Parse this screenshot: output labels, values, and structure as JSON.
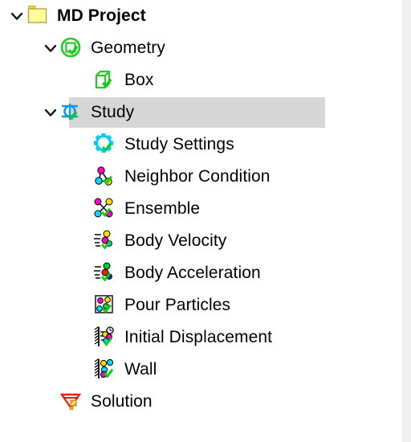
{
  "panel": {
    "name": "model-tree",
    "background": "#ffffff",
    "gutter_color": "#efefef",
    "selection_color": "#d6d6d6"
  },
  "tree": {
    "nodes": [
      {
        "id": "md-project",
        "label": "MD Project",
        "icon": "folder-icon",
        "indent": 0,
        "expanded": true,
        "has_twisty": true,
        "bold": true,
        "selected": false
      },
      {
        "id": "geometry",
        "label": "Geometry",
        "icon": "geometry-icon",
        "indent": 1,
        "expanded": true,
        "has_twisty": true,
        "bold": false,
        "selected": false
      },
      {
        "id": "box",
        "label": "Box",
        "icon": "box-icon",
        "indent": 2,
        "expanded": false,
        "has_twisty": false,
        "bold": false,
        "selected": false
      },
      {
        "id": "study",
        "label": "Study",
        "icon": "study-icon",
        "indent": 1,
        "expanded": true,
        "has_twisty": true,
        "bold": false,
        "selected": true
      },
      {
        "id": "study-settings",
        "label": "Study Settings",
        "icon": "gear-icon",
        "indent": 2,
        "expanded": false,
        "has_twisty": false,
        "bold": false,
        "selected": false
      },
      {
        "id": "neighbor-condition",
        "label": "Neighbor Condition",
        "icon": "neighbor-condition-icon",
        "indent": 2,
        "expanded": false,
        "has_twisty": false,
        "bold": false,
        "selected": false
      },
      {
        "id": "ensemble",
        "label": "Ensemble",
        "icon": "ensemble-icon",
        "indent": 2,
        "expanded": false,
        "has_twisty": false,
        "bold": false,
        "selected": false
      },
      {
        "id": "body-velocity",
        "label": "Body Velocity",
        "icon": "body-velocity-icon",
        "indent": 2,
        "expanded": false,
        "has_twisty": false,
        "bold": false,
        "selected": false
      },
      {
        "id": "body-acceleration",
        "label": "Body Acceleration",
        "icon": "body-acceleration-icon",
        "indent": 2,
        "expanded": false,
        "has_twisty": false,
        "bold": false,
        "selected": false
      },
      {
        "id": "pour-particles",
        "label": "Pour Particles",
        "icon": "pour-particles-icon",
        "indent": 2,
        "expanded": false,
        "has_twisty": false,
        "bold": false,
        "selected": false
      },
      {
        "id": "initial-displacement",
        "label": "Initial Displacement",
        "icon": "initial-displacement-icon",
        "indent": 2,
        "expanded": false,
        "has_twisty": false,
        "bold": false,
        "selected": false
      },
      {
        "id": "wall",
        "label": "Wall",
        "icon": "wall-icon",
        "indent": 2,
        "expanded": false,
        "has_twisty": false,
        "bold": false,
        "selected": false
      },
      {
        "id": "solution",
        "label": "Solution",
        "icon": "solution-icon",
        "indent": 1,
        "expanded": false,
        "has_twisty": false,
        "bold": false,
        "selected": false
      }
    ]
  },
  "colors": {
    "folder_fill": "#ffff99",
    "folder_stroke": "#b8a441",
    "green": "#22cc22",
    "bright_green": "#00dd00",
    "cyan": "#00ccff",
    "blue": "#1199ee",
    "magenta": "#ff00cc",
    "yellow": "#ffdd00",
    "red": "#ee2211",
    "dark_red": "#aa1111",
    "orange": "#ffaa22",
    "text": "#000000"
  }
}
